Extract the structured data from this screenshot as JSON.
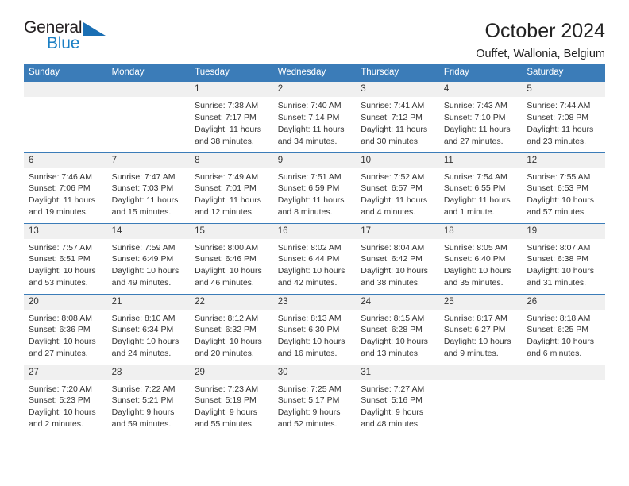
{
  "brand": {
    "name_top": "General",
    "name_bottom": "Blue",
    "accent_color": "#1b7fc4",
    "triangle_color": "#1a6fb4"
  },
  "header": {
    "title": "October 2024",
    "subtitle": "Ouffet, Wallonia, Belgium"
  },
  "theme": {
    "header_bg": "#3b7cb8",
    "daynum_bg": "#f0f0f0",
    "text": "#333333"
  },
  "weekday_headers": [
    "Sunday",
    "Monday",
    "Tuesday",
    "Wednesday",
    "Thursday",
    "Friday",
    "Saturday"
  ],
  "weeks": [
    [
      {
        "day": "",
        "info": ""
      },
      {
        "day": "",
        "info": ""
      },
      {
        "day": "1",
        "info": "Sunrise: 7:38 AM\nSunset: 7:17 PM\nDaylight: 11 hours\nand 38 minutes."
      },
      {
        "day": "2",
        "info": "Sunrise: 7:40 AM\nSunset: 7:14 PM\nDaylight: 11 hours\nand 34 minutes."
      },
      {
        "day": "3",
        "info": "Sunrise: 7:41 AM\nSunset: 7:12 PM\nDaylight: 11 hours\nand 30 minutes."
      },
      {
        "day": "4",
        "info": "Sunrise: 7:43 AM\nSunset: 7:10 PM\nDaylight: 11 hours\nand 27 minutes."
      },
      {
        "day": "5",
        "info": "Sunrise: 7:44 AM\nSunset: 7:08 PM\nDaylight: 11 hours\nand 23 minutes."
      }
    ],
    [
      {
        "day": "6",
        "info": "Sunrise: 7:46 AM\nSunset: 7:06 PM\nDaylight: 11 hours\nand 19 minutes."
      },
      {
        "day": "7",
        "info": "Sunrise: 7:47 AM\nSunset: 7:03 PM\nDaylight: 11 hours\nand 15 minutes."
      },
      {
        "day": "8",
        "info": "Sunrise: 7:49 AM\nSunset: 7:01 PM\nDaylight: 11 hours\nand 12 minutes."
      },
      {
        "day": "9",
        "info": "Sunrise: 7:51 AM\nSunset: 6:59 PM\nDaylight: 11 hours\nand 8 minutes."
      },
      {
        "day": "10",
        "info": "Sunrise: 7:52 AM\nSunset: 6:57 PM\nDaylight: 11 hours\nand 4 minutes."
      },
      {
        "day": "11",
        "info": "Sunrise: 7:54 AM\nSunset: 6:55 PM\nDaylight: 11 hours\nand 1 minute."
      },
      {
        "day": "12",
        "info": "Sunrise: 7:55 AM\nSunset: 6:53 PM\nDaylight: 10 hours\nand 57 minutes."
      }
    ],
    [
      {
        "day": "13",
        "info": "Sunrise: 7:57 AM\nSunset: 6:51 PM\nDaylight: 10 hours\nand 53 minutes."
      },
      {
        "day": "14",
        "info": "Sunrise: 7:59 AM\nSunset: 6:49 PM\nDaylight: 10 hours\nand 49 minutes."
      },
      {
        "day": "15",
        "info": "Sunrise: 8:00 AM\nSunset: 6:46 PM\nDaylight: 10 hours\nand 46 minutes."
      },
      {
        "day": "16",
        "info": "Sunrise: 8:02 AM\nSunset: 6:44 PM\nDaylight: 10 hours\nand 42 minutes."
      },
      {
        "day": "17",
        "info": "Sunrise: 8:04 AM\nSunset: 6:42 PM\nDaylight: 10 hours\nand 38 minutes."
      },
      {
        "day": "18",
        "info": "Sunrise: 8:05 AM\nSunset: 6:40 PM\nDaylight: 10 hours\nand 35 minutes."
      },
      {
        "day": "19",
        "info": "Sunrise: 8:07 AM\nSunset: 6:38 PM\nDaylight: 10 hours\nand 31 minutes."
      }
    ],
    [
      {
        "day": "20",
        "info": "Sunrise: 8:08 AM\nSunset: 6:36 PM\nDaylight: 10 hours\nand 27 minutes."
      },
      {
        "day": "21",
        "info": "Sunrise: 8:10 AM\nSunset: 6:34 PM\nDaylight: 10 hours\nand 24 minutes."
      },
      {
        "day": "22",
        "info": "Sunrise: 8:12 AM\nSunset: 6:32 PM\nDaylight: 10 hours\nand 20 minutes."
      },
      {
        "day": "23",
        "info": "Sunrise: 8:13 AM\nSunset: 6:30 PM\nDaylight: 10 hours\nand 16 minutes."
      },
      {
        "day": "24",
        "info": "Sunrise: 8:15 AM\nSunset: 6:28 PM\nDaylight: 10 hours\nand 13 minutes."
      },
      {
        "day": "25",
        "info": "Sunrise: 8:17 AM\nSunset: 6:27 PM\nDaylight: 10 hours\nand 9 minutes."
      },
      {
        "day": "26",
        "info": "Sunrise: 8:18 AM\nSunset: 6:25 PM\nDaylight: 10 hours\nand 6 minutes."
      }
    ],
    [
      {
        "day": "27",
        "info": "Sunrise: 7:20 AM\nSunset: 5:23 PM\nDaylight: 10 hours\nand 2 minutes."
      },
      {
        "day": "28",
        "info": "Sunrise: 7:22 AM\nSunset: 5:21 PM\nDaylight: 9 hours\nand 59 minutes."
      },
      {
        "day": "29",
        "info": "Sunrise: 7:23 AM\nSunset: 5:19 PM\nDaylight: 9 hours\nand 55 minutes."
      },
      {
        "day": "30",
        "info": "Sunrise: 7:25 AM\nSunset: 5:17 PM\nDaylight: 9 hours\nand 52 minutes."
      },
      {
        "day": "31",
        "info": "Sunrise: 7:27 AM\nSunset: 5:16 PM\nDaylight: 9 hours\nand 48 minutes."
      },
      {
        "day": "",
        "info": ""
      },
      {
        "day": "",
        "info": ""
      }
    ]
  ]
}
